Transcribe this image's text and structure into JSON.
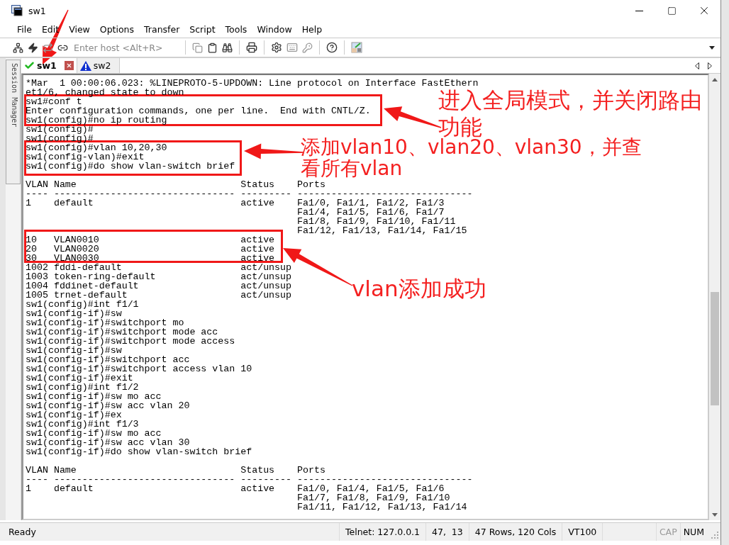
{
  "window": {
    "title": "sw1"
  },
  "menu": [
    "File",
    "Edit",
    "View",
    "Options",
    "Transfer",
    "Script",
    "Tools",
    "Window",
    "Help"
  ],
  "toolbar": {
    "host_field": {
      "placeholder": "Enter host <Alt+R>"
    }
  },
  "session_manager": {
    "label": "Session Manager"
  },
  "tabs": [
    {
      "label": "sw1",
      "selected": true,
      "kind": "connected"
    },
    {
      "label": "sw2",
      "selected": false,
      "kind": "warning"
    }
  ],
  "terminal": {
    "blocks": [
      [
        "*Mar  1 00:00:06.023: %LINEPROTO-5-UPDOWN: Line protocol on Interface FastEthern",
        "et1/6, changed state to down",
        "sw1#conf t",
        "Enter configuration commands, one per line.  End with CNTL/Z.",
        "sw1(config)#no ip routing",
        "sw1(config)#",
        "sw1(config)#",
        "sw1(config)#vlan 10,20,30",
        "sw1(config-vlan)#exit",
        "sw1(config)#do show vlan-switch brief"
      ],
      [
        "VLAN Name                             Status    Ports",
        "---- -------------------------------- --------- -------------------------------",
        "1    default                          active    Fa1/0, Fa1/1, Fa1/2, Fa1/3",
        "                                                Fa1/4, Fa1/5, Fa1/6, Fa1/7",
        "                                                Fa1/8, Fa1/9, Fa1/10, Fa1/11",
        "                                                Fa1/12, Fa1/13, Fa1/14, Fa1/15",
        "10   VLAN0010                         active",
        "20   VLAN0020                         active",
        "30   VLAN0030                         active",
        "1002 fddi-default                     act/unsup",
        "1003 token-ring-default               act/unsup",
        "1004 fddinet-default                  act/unsup",
        "1005 trnet-default                    act/unsup",
        "sw1(config)#int f1/1",
        "sw1(config-if)#sw",
        "sw1(config-if)#switchport mo",
        "sw1(config-if)#switchport mode acc",
        "sw1(config-if)#switchport mode access",
        "sw1(config-if)#sw",
        "sw1(config-if)#switchport acc",
        "sw1(config-if)#switchport access vlan 10",
        "sw1(config-if)#exit",
        "sw1(config)#int f1/2",
        "sw1(config-if)#sw mo acc",
        "sw1(config-if)#sw acc vlan 20",
        "sw1(config-if)#ex",
        "sw1(config)#int f1/3",
        "sw1(config-if)#sw mo acc",
        "sw1(config-if)#sw acc vlan 30",
        "sw1(config-if)#do show vlan-switch brief"
      ],
      [
        "VLAN Name                             Status    Ports",
        "---- -------------------------------- --------- -------------------------------",
        "1    default                          active    Fa1/0, Fa1/4, Fa1/5, Fa1/6",
        "                                                Fa1/7, Fa1/8, Fa1/9, Fa1/10",
        "                                                Fa1/11, Fa1/12, Fa1/13, Fa1/14"
      ]
    ]
  },
  "annotations": [
    {
      "text": "进入全局模式，并关闭路由功能"
    },
    {
      "text": "添加vlan10、vlan20、vlan30，并查看所有vlan"
    },
    {
      "text": "vlan添加成功"
    }
  ],
  "status_bar": {
    "message": "Ready",
    "fields": [
      "Telnet: 127.0.0.1",
      "47,  13",
      "47 Rows, 120 Cols",
      "VT100"
    ],
    "indicators": [
      {
        "label": "CAP",
        "on": false
      },
      {
        "label": "NUM",
        "on": true
      }
    ]
  }
}
